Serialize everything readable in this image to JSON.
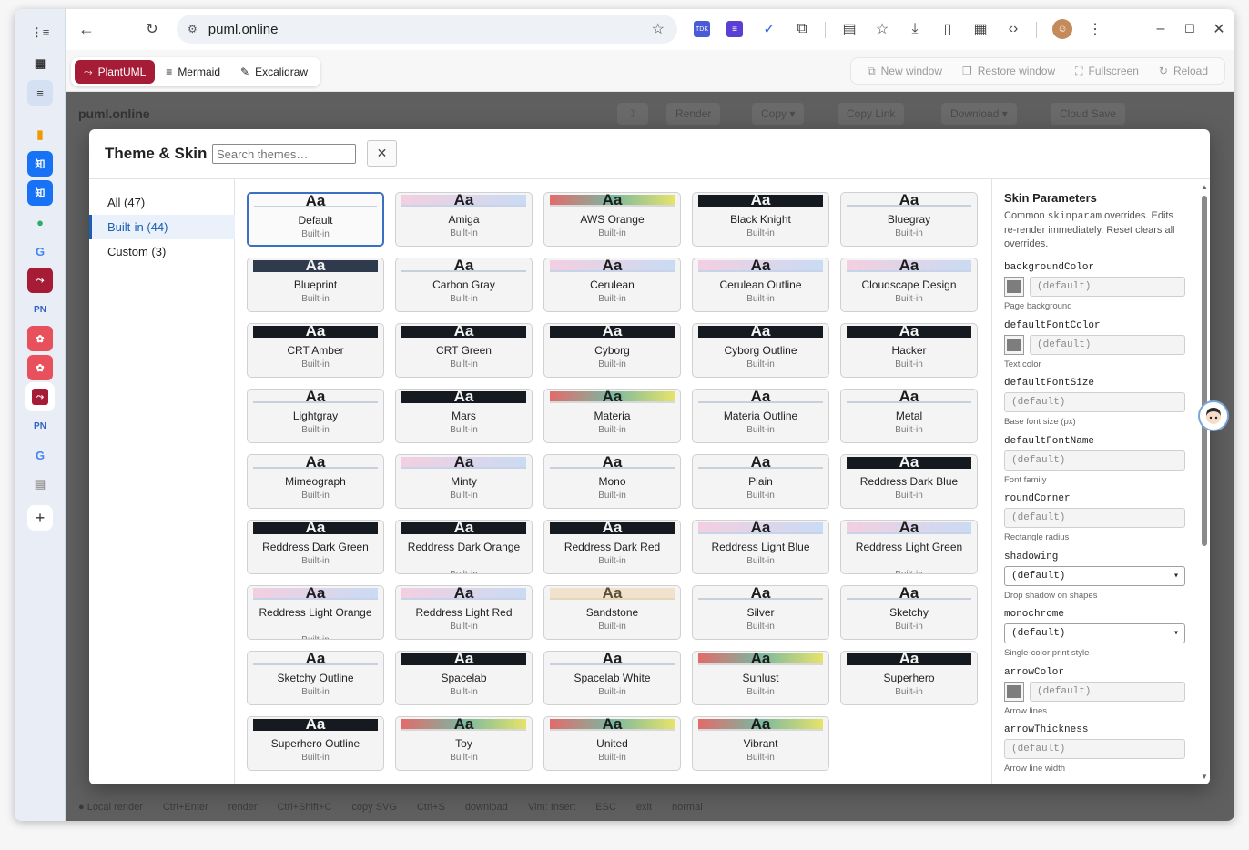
{
  "browser": {
    "url": "puml.online",
    "extensions": [
      "TDK",
      "forms-icon",
      "check-icon",
      "puzzle-icon"
    ]
  },
  "appbar": {
    "tabs": [
      {
        "label": "PlantUML",
        "icon": "flow-icon",
        "active": true
      },
      {
        "label": "Mermaid",
        "icon": "lines-icon",
        "active": false
      },
      {
        "label": "Excalidraw",
        "icon": "edit-icon",
        "active": false
      }
    ],
    "tools": [
      "New window",
      "Restore window",
      "Fullscreen",
      "Reload"
    ]
  },
  "modal": {
    "title": "Theme & Skin",
    "search_placeholder": "Search themes…",
    "close_label": "✕",
    "filters": [
      {
        "label": "All (47)",
        "active": false
      },
      {
        "label": "Built-in (44)",
        "active": true
      },
      {
        "label": "Custom (3)",
        "active": false
      }
    ],
    "selected_theme": "Default",
    "themes": [
      {
        "name": "Default",
        "badge": "Built-in",
        "style": "plain"
      },
      {
        "name": "Amiga",
        "badge": "Built-in",
        "style": "pink"
      },
      {
        "name": "AWS Orange",
        "badge": "Built-in",
        "style": "rainbow"
      },
      {
        "name": "Black Knight",
        "badge": "Built-in",
        "style": "dark"
      },
      {
        "name": "Bluegray",
        "badge": "Built-in",
        "style": "plain"
      },
      {
        "name": "Blueprint",
        "badge": "Built-in",
        "style": "navy"
      },
      {
        "name": "Carbon Gray",
        "badge": "Built-in",
        "style": "plain"
      },
      {
        "name": "Cerulean",
        "badge": "Built-in",
        "style": "pink"
      },
      {
        "name": "Cerulean Outline",
        "badge": "Built-in",
        "style": "pink"
      },
      {
        "name": "Cloudscape Design",
        "badge": "Built-in",
        "style": "pink"
      },
      {
        "name": "CRT Amber",
        "badge": "Built-in",
        "style": "dark"
      },
      {
        "name": "CRT Green",
        "badge": "Built-in",
        "style": "dark"
      },
      {
        "name": "Cyborg",
        "badge": "Built-in",
        "style": "dark"
      },
      {
        "name": "Cyborg Outline",
        "badge": "Built-in",
        "style": "dark"
      },
      {
        "name": "Hacker",
        "badge": "Built-in",
        "style": "dark"
      },
      {
        "name": "Lightgray",
        "badge": "Built-in",
        "style": "plain"
      },
      {
        "name": "Mars",
        "badge": "Built-in",
        "style": "dark"
      },
      {
        "name": "Materia",
        "badge": "Built-in",
        "style": "rainbow"
      },
      {
        "name": "Materia Outline",
        "badge": "Built-in",
        "style": "plain"
      },
      {
        "name": "Metal",
        "badge": "Built-in",
        "style": "plain"
      },
      {
        "name": "Mimeograph",
        "badge": "Built-in",
        "style": "plain"
      },
      {
        "name": "Minty",
        "badge": "Built-in",
        "style": "pink"
      },
      {
        "name": "Mono",
        "badge": "Built-in",
        "style": "plain"
      },
      {
        "name": "Plain",
        "badge": "Built-in",
        "style": "plain"
      },
      {
        "name": "Reddress Dark Blue",
        "badge": "Built-in",
        "style": "dark"
      },
      {
        "name": "Reddress Dark Green",
        "badge": "Built-in",
        "style": "dark"
      },
      {
        "name": "Reddress Dark Orange",
        "badge": "Built-in",
        "style": "dark"
      },
      {
        "name": "Reddress Dark Red",
        "badge": "Built-in",
        "style": "dark"
      },
      {
        "name": "Reddress Light Blue",
        "badge": "Built-in",
        "style": "pink"
      },
      {
        "name": "Reddress Light Green",
        "badge": "Built-in",
        "style": "pink"
      },
      {
        "name": "Reddress Light Orange",
        "badge": "Built-in",
        "style": "pink"
      },
      {
        "name": "Reddress Light Red",
        "badge": "Built-in",
        "style": "pink"
      },
      {
        "name": "Sandstone",
        "badge": "Built-in",
        "style": "sand"
      },
      {
        "name": "Silver",
        "badge": "Built-in",
        "style": "plain"
      },
      {
        "name": "Sketchy",
        "badge": "Built-in",
        "style": "plain"
      },
      {
        "name": "Sketchy Outline",
        "badge": "Built-in",
        "style": "plain"
      },
      {
        "name": "Spacelab",
        "badge": "Built-in",
        "style": "dark"
      },
      {
        "name": "Spacelab White",
        "badge": "Built-in",
        "style": "plain"
      },
      {
        "name": "Sunlust",
        "badge": "Built-in",
        "style": "rainbow"
      },
      {
        "name": "Superhero",
        "badge": "Built-in",
        "style": "dark"
      },
      {
        "name": "Superhero Outline",
        "badge": "Built-in",
        "style": "dark"
      },
      {
        "name": "Toy",
        "badge": "Built-in",
        "style": "rainbow"
      },
      {
        "name": "United",
        "badge": "Built-in",
        "style": "rainbow"
      },
      {
        "name": "Vibrant",
        "badge": "Built-in",
        "style": "rainbow"
      }
    ],
    "swatch_text": "Aa"
  },
  "skin": {
    "title": "Skin Parameters",
    "desc_pre": "Common ",
    "desc_code": "skinparam",
    "desc_post": " overrides. Edits re-render immediately. Reset clears all overrides.",
    "params": [
      {
        "name": "backgroundColor",
        "kind": "color",
        "value": "(default)",
        "hint": "Page background"
      },
      {
        "name": "defaultFontColor",
        "kind": "color",
        "value": "(default)",
        "hint": "Text color"
      },
      {
        "name": "defaultFontSize",
        "kind": "text",
        "value": "(default)",
        "hint": "Base font size (px)"
      },
      {
        "name": "defaultFontName",
        "kind": "text",
        "value": "(default)",
        "hint": "Font family"
      },
      {
        "name": "roundCorner",
        "kind": "text",
        "value": "(default)",
        "hint": "Rectangle radius"
      },
      {
        "name": "shadowing",
        "kind": "select",
        "value": "(default)",
        "hint": "Drop shadow on shapes"
      },
      {
        "name": "monochrome",
        "kind": "select",
        "value": "(default)",
        "hint": "Single-color print style"
      },
      {
        "name": "arrowColor",
        "kind": "color",
        "value": "(default)",
        "hint": "Arrow lines"
      },
      {
        "name": "arrowThickness",
        "kind": "text",
        "value": "(default)",
        "hint": "Arrow line width"
      }
    ]
  },
  "background": {
    "site": "puml.online",
    "toolbar": [
      "Render",
      "Copy ▾",
      "Copy Link",
      "Download ▾",
      "Cloud Save"
    ],
    "footer": [
      "● Local render",
      "Ctrl+Enter",
      "render",
      "Ctrl+Shift+C",
      "copy SVG",
      "Ctrl+S",
      "download",
      "Vim: Insert",
      "ESC",
      "exit",
      "normal"
    ]
  }
}
